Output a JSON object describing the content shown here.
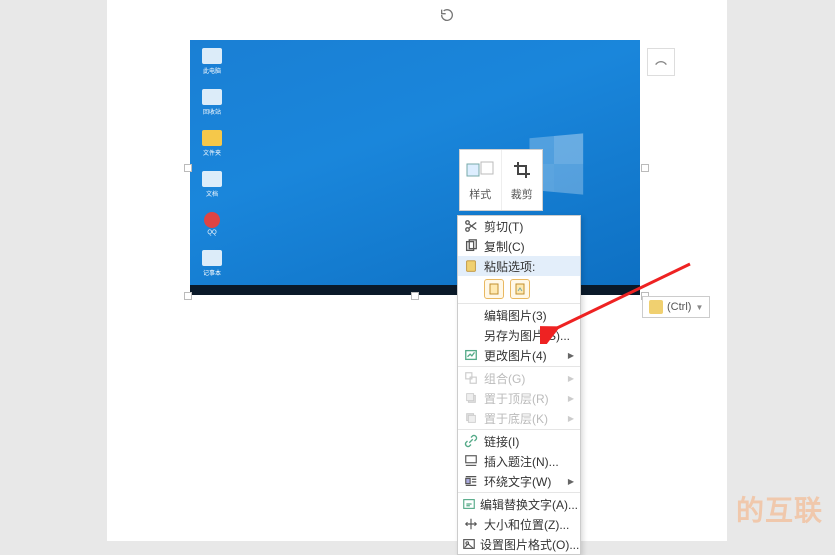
{
  "mini_toolbar": {
    "style_label": "样式",
    "crop_label": "裁剪"
  },
  "ctrl_pill": "(Ctrl)",
  "context_menu": {
    "cut": "剪切(T)",
    "copy": "复制(C)",
    "paste_options": "粘贴选项:",
    "edit_picture": "编辑图片(3)",
    "save_as_picture": "另存为图片(S)...",
    "change_picture": "更改图片(4)",
    "group": "组合(G)",
    "bring_to_front": "置于顶层(R)",
    "send_to_back": "置于底层(K)",
    "link": "链接(I)",
    "insert_caption": "插入题注(N)...",
    "wrap_text": "环绕文字(W)",
    "edit_alt_text": "编辑替换文字(A)...",
    "size_and_position": "大小和位置(Z)...",
    "format_picture": "设置图片格式(O)..."
  },
  "desktop": {
    "icons": [
      "此电脑",
      "回收站",
      "文件夹",
      "文档",
      "QQ",
      "记事本"
    ]
  },
  "watermark": "的互联"
}
